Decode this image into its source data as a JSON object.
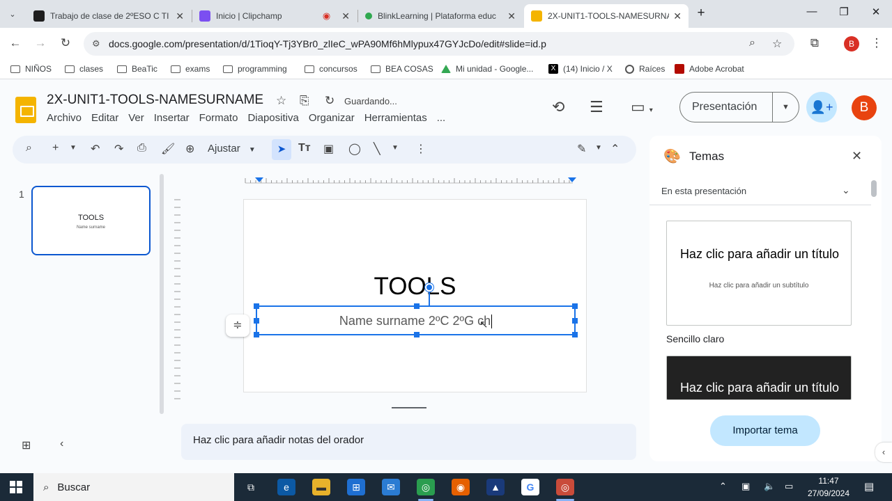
{
  "browser": {
    "tabs": [
      {
        "title": "Trabajo de clase de 2ºESO C TI",
        "active": false
      },
      {
        "title": "Inicio | Clipchamp",
        "active": false
      },
      {
        "title": "BlinkLearning | Plataforma educ",
        "active": false
      },
      {
        "title": "2X-UNIT1-TOOLS-NAMESURNA",
        "active": true
      }
    ],
    "new_tab": "+",
    "url": "docs.google.com/presentation/d/1TioqY-Tj3YBr0_zlIeC_wPA90Mf6hMlypux47GYJcDo/edit#slide=id.p",
    "profile_letter": "B",
    "bookmarks": [
      {
        "label": "NIÑOS",
        "icon": "folder-icon"
      },
      {
        "label": "clases",
        "icon": "folder-icon"
      },
      {
        "label": "BeaTic",
        "icon": "folder-icon"
      },
      {
        "label": "exams",
        "icon": "folder-icon"
      },
      {
        "label": "programming",
        "icon": "folder-icon"
      },
      {
        "label": "concursos",
        "icon": "folder-icon"
      },
      {
        "label": "BEA COSAS",
        "icon": "folder-icon"
      },
      {
        "label": "Mi unidad - Google...",
        "icon": "drive-icon"
      },
      {
        "label": "(14) Inicio / X",
        "icon": "x-icon"
      },
      {
        "label": "Raíces",
        "icon": "globe-icon"
      },
      {
        "label": "Adobe Acrobat",
        "icon": "acrobat-icon"
      }
    ]
  },
  "slides": {
    "doc_title": "2X-UNIT1-TOOLS-NAMESURNAME",
    "save_status": "Guardando...",
    "menu": [
      "Archivo",
      "Editar",
      "Ver",
      "Insertar",
      "Formato",
      "Diapositiva",
      "Organizar",
      "Herramientas",
      "..."
    ],
    "present_label": "Presentación",
    "account_letter": "B",
    "zoom_label": "Ajustar",
    "filmstrip": {
      "number": "1",
      "thumb_title": "TOOLS",
      "thumb_subtitle": "Name surname"
    },
    "slide": {
      "title": "TOOLS",
      "subtitle": "Name surname 2ºC 2ºG ch"
    },
    "notes_placeholder": "Haz clic para añadir notas del orador"
  },
  "themes": {
    "title": "Temas",
    "scope": "En esta presentación",
    "cards": [
      {
        "title": "Haz clic para añadir un título",
        "subtitle": "Haz clic para añadir un subtítulo",
        "name": "Sencillo claro"
      },
      {
        "title": "Haz clic para añadir un título"
      }
    ],
    "import_label": "Importar tema"
  },
  "taskbar": {
    "search_label": "Buscar",
    "time": "11:47",
    "date": "27/09/2024"
  },
  "colors": {
    "accent_blue": "#1a73e8",
    "slides_yellow": "#f4b400",
    "light_blue_button": "#c2e7ff"
  }
}
